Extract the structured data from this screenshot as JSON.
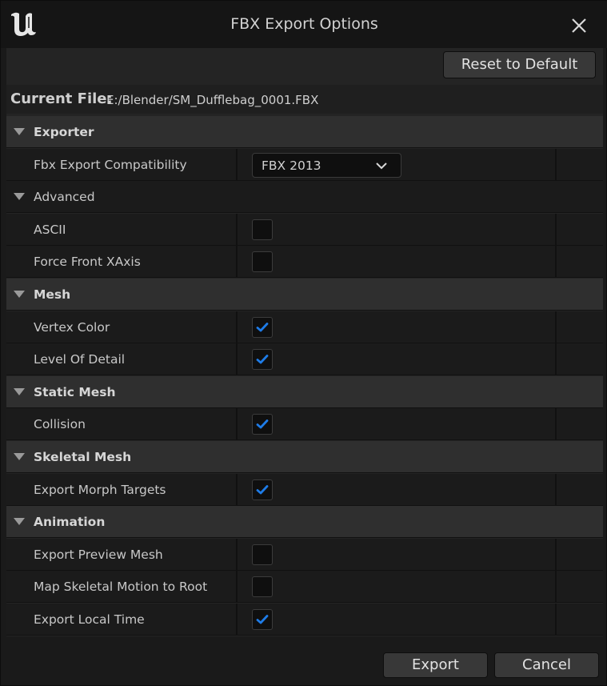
{
  "window": {
    "title": "FBX Export Options"
  },
  "toolbar": {
    "reset_label": "Reset to Default"
  },
  "current_file": {
    "label": "Current File:",
    "value": "E:/Blender/SM_Dufflebag_0001.FBX"
  },
  "rows": [
    {
      "type": "cat",
      "label": "Exporter"
    },
    {
      "type": "prop",
      "label": "Fbx Export Compatibility",
      "control": "dropdown",
      "value": "FBX 2013"
    },
    {
      "type": "subcat",
      "label": "Advanced"
    },
    {
      "type": "prop",
      "label": "ASCII",
      "control": "checkbox",
      "checked": false
    },
    {
      "type": "prop",
      "label": "Force Front XAxis",
      "control": "checkbox",
      "checked": false
    },
    {
      "type": "cat",
      "label": "Mesh"
    },
    {
      "type": "prop",
      "label": "Vertex Color",
      "control": "checkbox",
      "checked": true
    },
    {
      "type": "prop",
      "label": "Level Of Detail",
      "control": "checkbox",
      "checked": true
    },
    {
      "type": "cat",
      "label": "Static Mesh"
    },
    {
      "type": "prop",
      "label": "Collision",
      "control": "checkbox",
      "checked": true
    },
    {
      "type": "cat",
      "label": "Skeletal Mesh"
    },
    {
      "type": "prop",
      "label": "Export Morph Targets",
      "control": "checkbox",
      "checked": true
    },
    {
      "type": "cat",
      "label": "Animation"
    },
    {
      "type": "prop",
      "label": "Export Preview Mesh",
      "control": "checkbox",
      "checked": false
    },
    {
      "type": "prop",
      "label": "Map Skeletal Motion to Root",
      "control": "checkbox",
      "checked": false
    },
    {
      "type": "prop",
      "label": "Export Local Time",
      "control": "checkbox",
      "checked": true
    }
  ],
  "footer": {
    "export_label": "Export",
    "cancel_label": "Cancel"
  },
  "colors": {
    "check_accent": "#1e7ce8",
    "panel_bg": "#242424",
    "category_bg": "#2f2f2f"
  },
  "icons": {
    "logo": "unreal-logo-icon",
    "close": "close-icon",
    "expand": "triangle-down-icon",
    "dropdown": "chevron-down-icon",
    "check": "checkmark-icon"
  }
}
